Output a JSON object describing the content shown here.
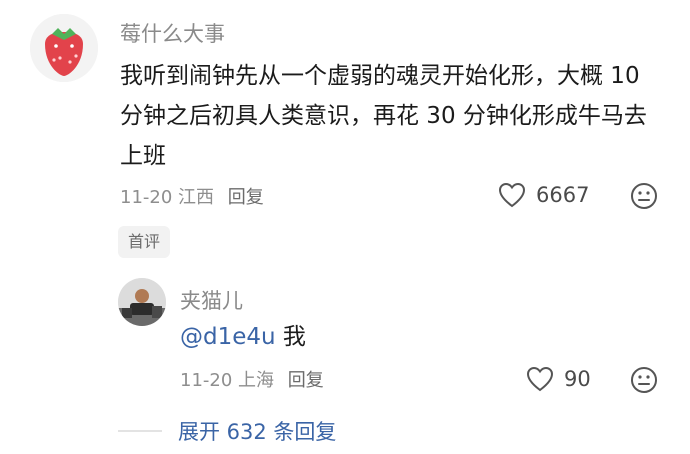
{
  "comment": {
    "username": "莓什么大事",
    "text": "我听到闹钟先从一个虚弱的魂灵开始化形，大概 10 分钟之后初具人类意识，再花 30 分钟化形成牛马去上班",
    "date": "11-20",
    "location": "江西",
    "reply_label": "回复",
    "likes": "6667",
    "tag": "首评",
    "avatar_icon": "strawberry-avatar-icon"
  },
  "reply": {
    "username": "夹猫儿",
    "mention": "@d1e4u",
    "text": " 我",
    "date": "11-20",
    "location": "上海",
    "reply_label": "回复",
    "likes": "90",
    "avatar_icon": "person-avatar-icon"
  },
  "expand_replies": "展开 632 条回复",
  "colors": {
    "link": "#3a64a6",
    "secondary_text": "#8a8a8a",
    "primary_text": "#1b1b1b"
  }
}
